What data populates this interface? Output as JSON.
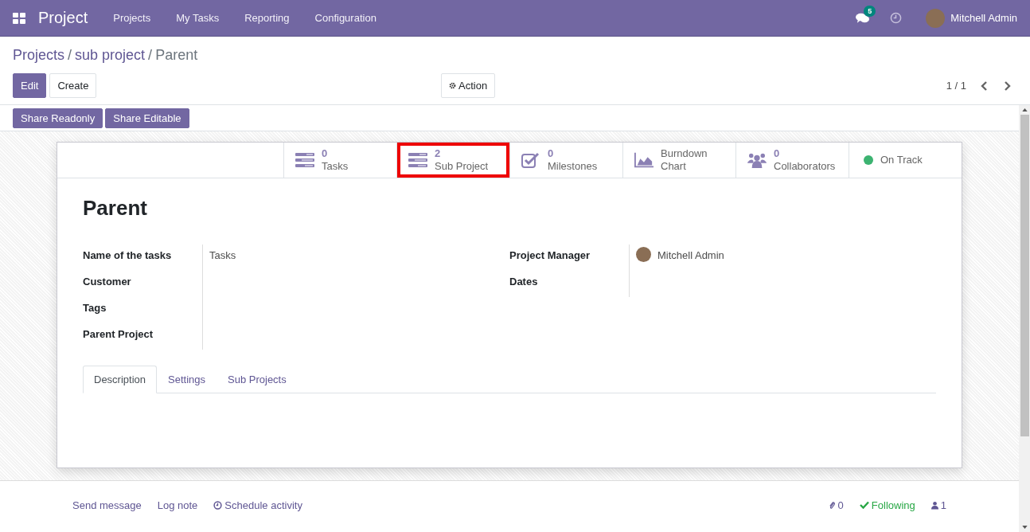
{
  "navbar": {
    "app_name": "Project",
    "menu": [
      "Projects",
      "My Tasks",
      "Reporting",
      "Configuration"
    ],
    "messages_badge": "5",
    "user": "Mitchell Admin"
  },
  "breadcrumbs": [
    {
      "label": "Projects",
      "kind": "link"
    },
    {
      "label": "sub project",
      "kind": "link"
    },
    {
      "label": "Parent",
      "kind": "current"
    }
  ],
  "breadcrumb_separators": [
    "/",
    "/"
  ],
  "buttons": [
    {
      "label": "Edit",
      "primary": true
    },
    {
      "label": "Create",
      "primary": false
    }
  ],
  "action": "Action",
  "pager": "1 / 1",
  "share_buttons": [
    "Share Readonly",
    "Share Editable"
  ],
  "stat_buttons": [
    {
      "kind": "list",
      "count": "0",
      "label": "Tasks",
      "highlighted": false
    },
    {
      "kind": "list",
      "count": "2",
      "label": "Sub Project",
      "highlighted": true
    },
    {
      "kind": "check",
      "count": "0",
      "label": "Milestones",
      "highlighted": false
    },
    {
      "kind": "chart",
      "label": "Burndown Chart",
      "highlighted": false
    },
    {
      "kind": "people",
      "count": "0",
      "label": "Collaborators",
      "highlighted": false
    },
    {
      "kind": "status",
      "label": "On Track",
      "highlighted": false,
      "color": "#3cb371"
    }
  ],
  "title": "Parent",
  "left_fields": [
    {
      "label": "Name of the tasks",
      "value": "Tasks"
    },
    {
      "label": "Customer"
    },
    {
      "label": "Tags"
    },
    {
      "label": "Parent Project"
    }
  ],
  "right_fields": [
    {
      "label": "Project Manager",
      "value": "Mitchell Admin",
      "avatar": true
    },
    {
      "label": "Dates",
      "avatar": false
    }
  ],
  "tabs": [
    {
      "label": "Description",
      "selected": true
    },
    {
      "label": "Settings",
      "selected": false
    },
    {
      "label": "Sub Projects",
      "selected": false
    }
  ],
  "chatter": {
    "actions": [
      "Send message",
      "Log note",
      "Schedule activity"
    ],
    "attachments": "0",
    "following": "Following",
    "followers": "1"
  }
}
